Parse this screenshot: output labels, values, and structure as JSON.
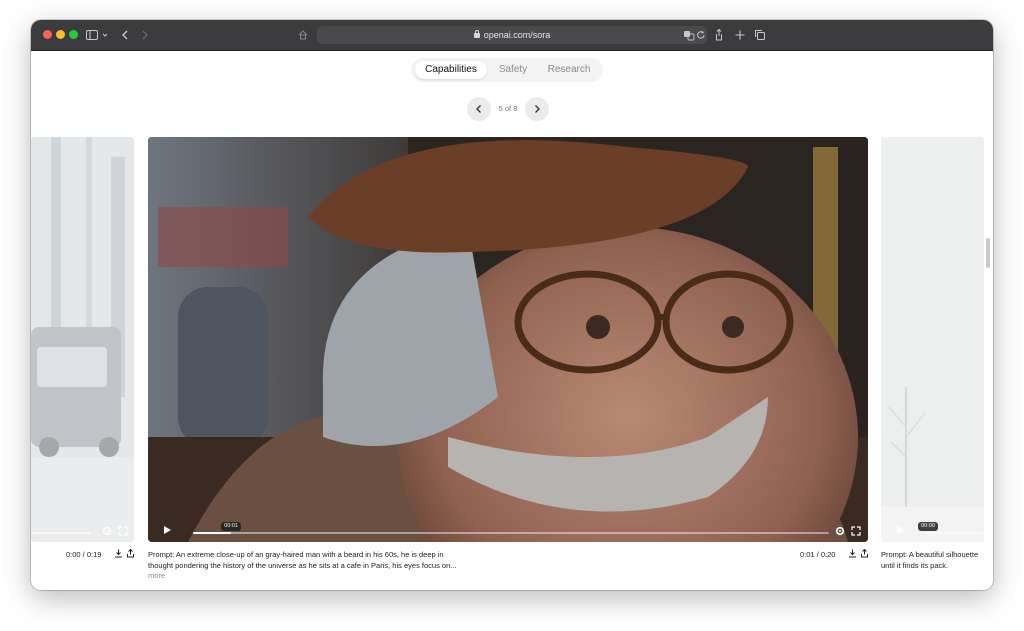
{
  "browser": {
    "url": "openai.com/sora"
  },
  "tabs": [
    {
      "label": "Capabilities",
      "active": true
    },
    {
      "label": "Safety",
      "active": false
    },
    {
      "label": "Research",
      "active": false
    }
  ],
  "carousel": {
    "counter": "5 of 8"
  },
  "videos": {
    "left": {
      "duration": "0:00 / 0:19"
    },
    "main": {
      "current_time_bubble": "00:01",
      "duration": "0:01 / 0:20",
      "progress_fraction": 0.06,
      "prompt_line1": "Prompt: An extreme close-up of an gray-haired man with a beard in his 60s, he is deep in",
      "prompt_line2": "thought pondering the history of the universe as he sits at a cafe in Paris, his eyes focus on...",
      "more": "more"
    },
    "right": {
      "current_time_bubble": "00:00",
      "prompt_line1": "Prompt: A beautiful silhouette",
      "prompt_line2": "until it finds its pack."
    }
  },
  "icons": {
    "sidebar": "sidebar-icon",
    "back": "chevron-left-icon",
    "forward": "chevron-right-icon",
    "home": "home-icon",
    "translate": "translate-icon",
    "reload": "reload-icon",
    "share": "share-icon",
    "new_tab": "plus-icon",
    "tabs_overview": "tabs-icon",
    "play": "play-icon",
    "settings": "gear-icon",
    "fullscreen": "fullscreen-icon",
    "download": "download-icon"
  },
  "colors": {
    "toolbar_bg": "#3b3b3e",
    "tab_active_bg": "#ffffff",
    "tabs_bg": "#f3f3f3"
  }
}
